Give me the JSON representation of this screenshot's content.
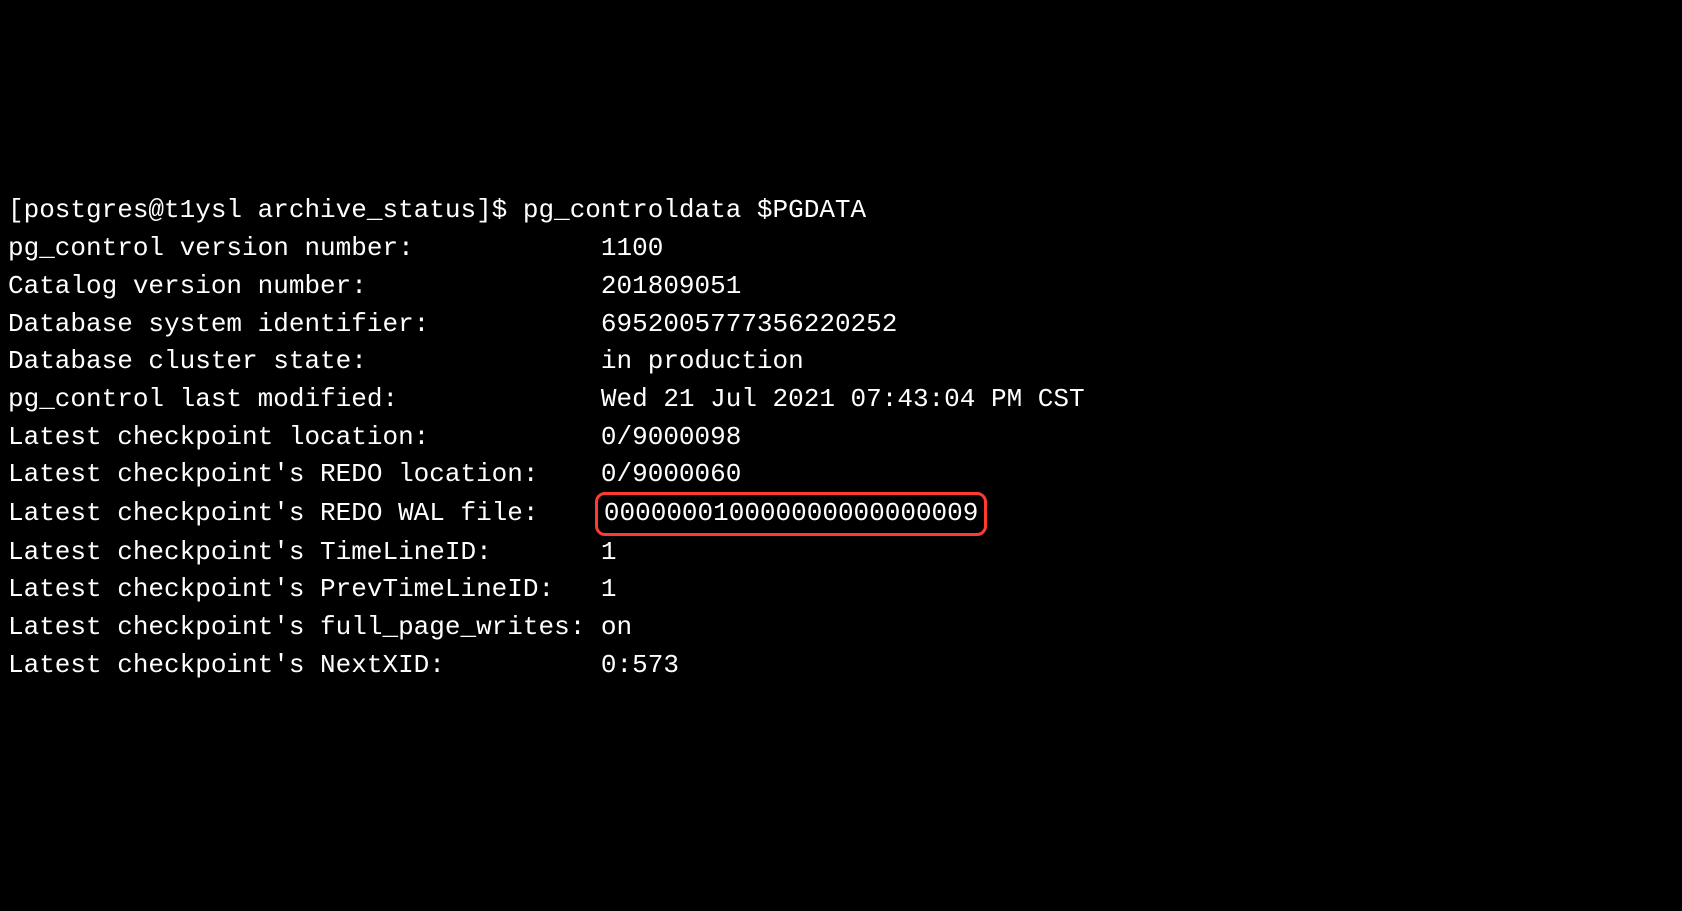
{
  "prompt": "[postgres@t1ysl archive_status]$ pg_controldata $PGDATA",
  "lines": [
    {
      "label": "pg_control version number:            ",
      "value": "1100"
    },
    {
      "label": "Catalog version number:               ",
      "value": "201809051"
    },
    {
      "label": "Database system identifier:           ",
      "value": "6952005777356220252"
    },
    {
      "label": "Database cluster state:               ",
      "value": "in production"
    },
    {
      "label": "pg_control last modified:             ",
      "value": "Wed 21 Jul 2021 07:43:04 PM CST"
    },
    {
      "label": "Latest checkpoint location:           ",
      "value": "0/9000098"
    },
    {
      "label": "Latest checkpoint's REDO location:    ",
      "value": "0/9000060"
    },
    {
      "label": "Latest checkpoint's REDO WAL file:    ",
      "value": "000000010000000000000009",
      "highlight": true
    },
    {
      "label": "Latest checkpoint's TimeLineID:       ",
      "value": "1"
    },
    {
      "label": "Latest checkpoint's PrevTimeLineID:   ",
      "value": "1"
    },
    {
      "label": "Latest checkpoint's full_page_writes: ",
      "value": "on"
    },
    {
      "label": "Latest checkpoint's NextXID:          ",
      "value": "0:573"
    }
  ]
}
